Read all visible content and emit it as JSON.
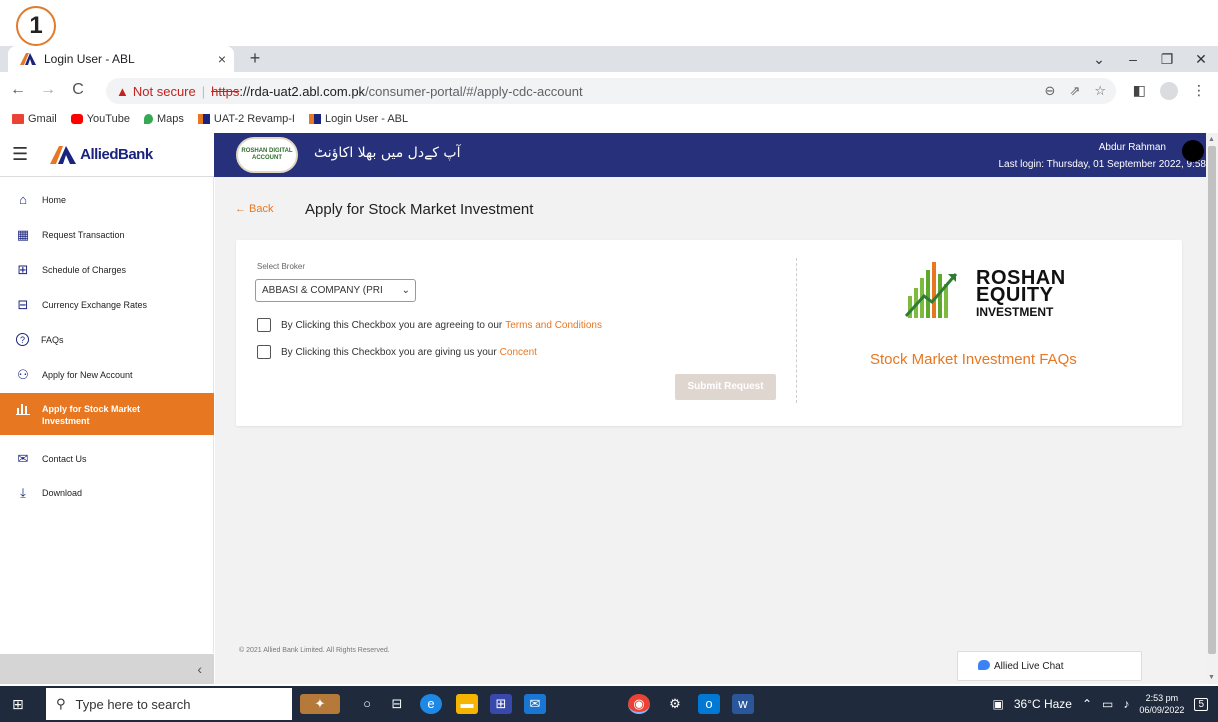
{
  "step_number": "1",
  "browser": {
    "tab_title": "Login User - ABL",
    "tab_close": "×",
    "new_tab": "+",
    "window_controls": [
      "⌄",
      "–",
      "❐",
      "✕"
    ],
    "not_secure": "Not secure",
    "url_proto": "https",
    "url_host": "://rda-uat2.abl.com.pk",
    "url_path": "/consumer-portal/#/apply-cdc-account",
    "bookmarks": [
      {
        "label": "Gmail",
        "color": "#ea4335"
      },
      {
        "label": "YouTube",
        "color": "#ff0000"
      },
      {
        "label": "Maps",
        "color": "#34a853"
      },
      {
        "label": "UAT-2 Revamp-I",
        "color": "#1a237e"
      },
      {
        "label": "Login User - ABL",
        "color": "#1a237e"
      }
    ]
  },
  "header": {
    "bank_name": "AlliedBank",
    "rda_badge": "ROSHAN DIGITAL ACCOUNT",
    "urdu_tagline": "آپ کےدل میں بھلا اکاؤنٹ",
    "user_name": "Abdur Rahman",
    "last_login": "Last login: Thursday, 01 September 2022, 9:58"
  },
  "sidebar": {
    "items": [
      {
        "label": "Home",
        "icon": "⌂"
      },
      {
        "label": "Request Transaction",
        "icon": "▦"
      },
      {
        "label": "Schedule of Charges",
        "icon": "⊞"
      },
      {
        "label": "Currency Exchange Rates",
        "icon": "⊟"
      },
      {
        "label": "FAQs",
        "icon": "?"
      },
      {
        "label": "Apply for New Account",
        "icon": "⚇"
      },
      {
        "label": "Apply for Stock Market",
        "label2": "Investment",
        "icon": "▮"
      },
      {
        "label": "Contact Us",
        "icon": "✉"
      },
      {
        "label": "Download",
        "icon": "⤓"
      }
    ],
    "collapse_icon": "‹"
  },
  "main": {
    "back_label": "← Back",
    "title": "Apply for Stock Market Investment",
    "broker_label": "Select Broker",
    "broker_value": "ABBASI & COMPANY (PRI",
    "terms_text": "By Clicking this Checkbox you are agreeing to our",
    "terms_link": "Terms and Conditions",
    "concent_text": "By Clicking this Checkbox you are giving us your",
    "concent_link": "Concent",
    "submit_label": "Submit Request",
    "roshan_line1": "ROSHAN",
    "roshan_line2": "EQUITY",
    "roshan_line3": "INVESTMENT",
    "faq_link": "Stock Market Investment FAQs",
    "footer": "© 2021 Allied Bank Limited. All Rights Reserved.",
    "live_chat": "Allied Live Chat"
  },
  "taskbar": {
    "search_placeholder": "Type here to search",
    "weather": "36°C  Haze",
    "time": "2:53 pm",
    "date": "06/09/2022",
    "notif_count": "5"
  },
  "colors": {
    "accent": "#e87722",
    "header_navy": "#27307a"
  }
}
